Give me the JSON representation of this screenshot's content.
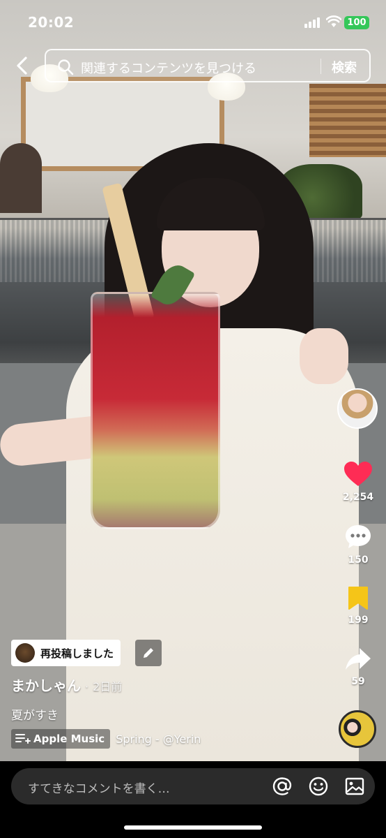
{
  "status_bar": {
    "time": "20:02",
    "battery": "100"
  },
  "search": {
    "placeholder": "関連するコンテンツを見つける",
    "button_label": "検索"
  },
  "side_actions": {
    "likes": "2,254",
    "comments": "150",
    "saves": "199",
    "shares": "59"
  },
  "post": {
    "repost_label": "再投稿しました",
    "author": "まかしゃん",
    "separator": "·",
    "time_ago": "2日前",
    "caption": "夏がすき",
    "music_service": "Apple Music",
    "song": "Spring - @Yerin"
  },
  "comment": {
    "placeholder": "すてきなコメントを書く…"
  },
  "colors": {
    "like_heart": "#fe2c55",
    "save_bookmark": "#f5c518",
    "battery_green": "#34c759"
  }
}
